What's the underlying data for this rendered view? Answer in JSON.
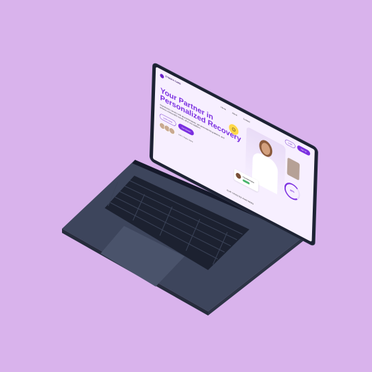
{
  "colors": {
    "background": "#d9b3ec",
    "accent": "#7b2fe0",
    "laptop_body": "#3d455c"
  },
  "site": {
    "logo_text": "ZYNERA CARE",
    "nav": [
      "Home",
      "About",
      "Contact"
    ],
    "login_label": "Login",
    "signup_label": "Sign up",
    "hero_title": "Your Partner in Personalized Recovery",
    "hero_description": "Seamlessly connect with physiotherapists, get personalized guidance, and achieve measurable results, all in one platform.",
    "primary_button": "Get Started",
    "secondary_button": "Learn more",
    "users_text": "10K+ Happy Users",
    "progress_value": "85%",
    "mini_card_name": "Physiotherapist",
    "partners_heading": "OUR TRUSTED PARTNERS"
  },
  "icons": [
    "smiley-face-icon",
    "progress-ring-icon"
  ]
}
